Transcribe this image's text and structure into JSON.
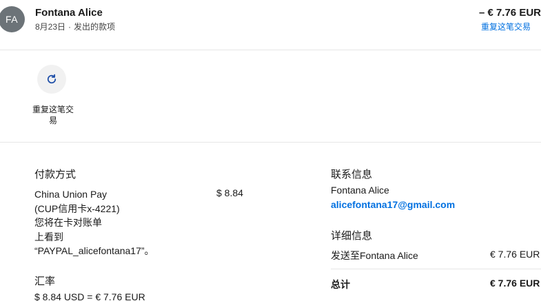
{
  "header": {
    "avatar_initials": "FA",
    "name": "Fontana Alice",
    "date": "8月23日",
    "separator": "·",
    "type": "发出的款项",
    "amount": "– € 7.76 EUR",
    "repeat_link": "重复这笔交易"
  },
  "action": {
    "icon": "refresh-icon",
    "label": "重复这笔交易"
  },
  "payment": {
    "title": "付款方式",
    "lines": [
      "China Union Pay",
      "(CUP信用卡x-4221)",
      "您将在卡对账单",
      "上看到",
      "“PAYPAL_alicefontana17”。"
    ],
    "amount": "$ 8.84"
  },
  "exchange": {
    "title": "汇率",
    "value": "$ 8.84 USD = € 7.76 EUR"
  },
  "contact": {
    "title": "联系信息",
    "name": "Fontana Alice",
    "email": "alicefontana17@gmail.com"
  },
  "details": {
    "title": "详细信息",
    "sent_to_label": "发送至Fontana Alice",
    "sent_to_amount": "€ 7.76 EUR",
    "total_label": "总计",
    "total_amount": "€ 7.76 EUR"
  },
  "colors": {
    "link": "#0070e0",
    "avatar": "#6c7378",
    "action_bg": "#f1f1f1"
  }
}
